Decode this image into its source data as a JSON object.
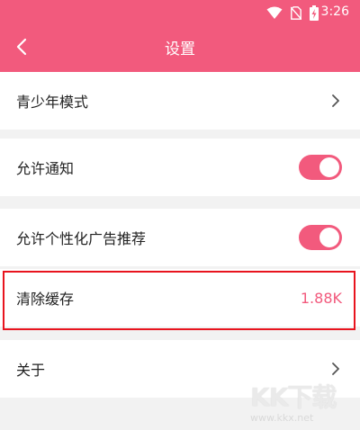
{
  "status_bar": {
    "time": "3:26",
    "icons": [
      "wifi-icon",
      "no-sim-icon",
      "battery-charging-icon"
    ]
  },
  "header": {
    "title": "设置",
    "back_icon": "chevron-left-icon",
    "background_color": "#f25a7d"
  },
  "settings": {
    "youth_mode": {
      "label": "青少年模式",
      "icon": "chevron-right-icon"
    },
    "allow_notifications": {
      "label": "允许通知",
      "enabled": true
    },
    "personalized_ads": {
      "label": "允许个性化广告推荐",
      "enabled": true
    },
    "clear_cache": {
      "label": "清除缓存",
      "value": "1.88K",
      "highlighted": true
    },
    "about": {
      "label": "关于",
      "icon": "chevron-right-icon"
    }
  },
  "colors": {
    "accent": "#f25a7d",
    "highlight_border": "#e8141e"
  },
  "watermark": {
    "logo_text": "KK下载",
    "url": "www.kkx.net"
  }
}
